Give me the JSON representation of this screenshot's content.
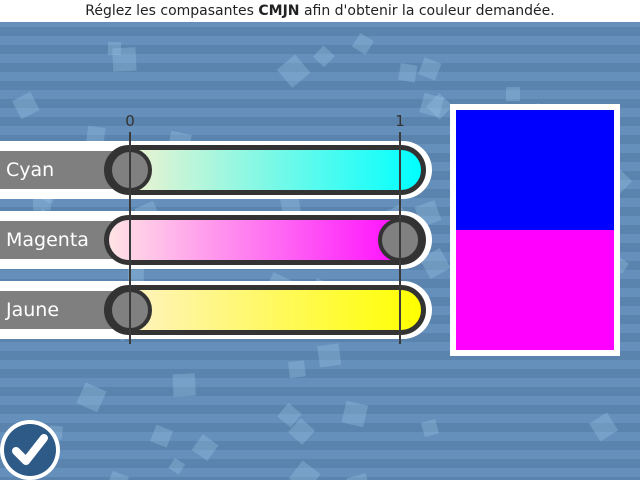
{
  "instruction": {
    "before": "Réglez les compasantes ",
    "bold": "CMJN",
    "after": " afin d'obtenir la couleur demandée."
  },
  "scale": {
    "min_label": "0",
    "max_label": "1"
  },
  "sliders": [
    {
      "label": "Cyan",
      "value": 0,
      "gradient_from": "#fff2cc",
      "gradient_to": "#00ffff"
    },
    {
      "label": "Magenta",
      "value": 1,
      "gradient_from": "#ffe4e4",
      "gradient_to": "#ff00ff"
    },
    {
      "label": "Jaune",
      "value": 0,
      "gradient_from": "#fff2cc",
      "gradient_to": "#ffff00"
    }
  ],
  "preview": {
    "target_color": "#0000ff",
    "current_color": "#ff00ff"
  },
  "icons": {
    "validate": "checkmark-icon"
  }
}
